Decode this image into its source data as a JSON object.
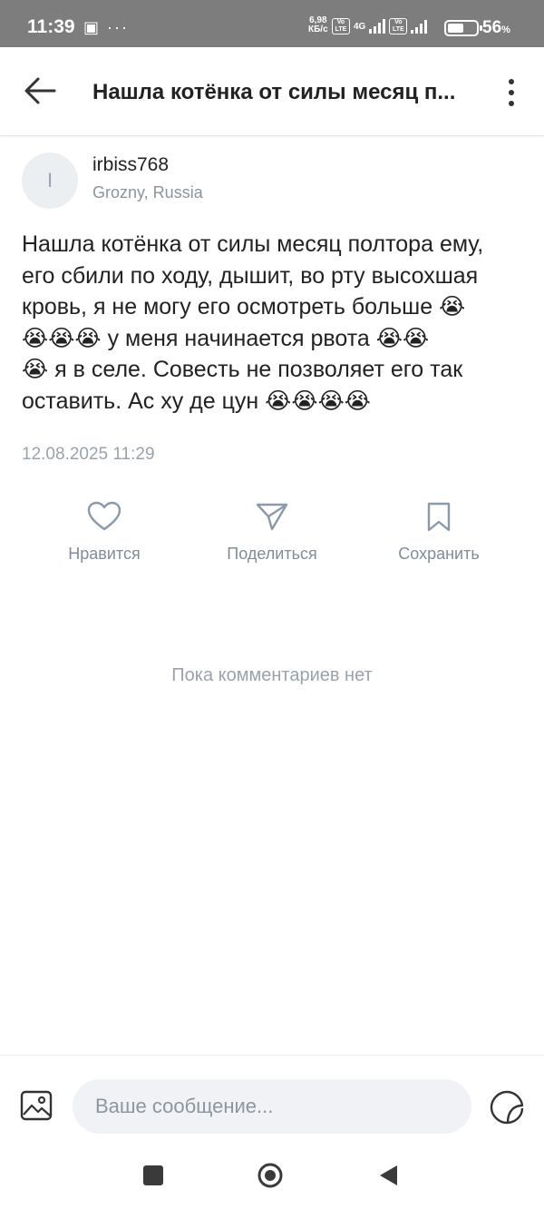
{
  "status_bar": {
    "time": "11:39",
    "left_icons": "▣ ···",
    "speed_value": "6,98",
    "speed_unit": "КБ/с",
    "volte1": "Vo LTE",
    "net": "4G",
    "volte2": "Vo LTE",
    "battery_level": 0.56,
    "battery_text": "56",
    "battery_unit": "%"
  },
  "header": {
    "title": "Нашла котёнка от силы месяц п...",
    "back_icon": "arrow-left-icon",
    "more_icon": "more-vertical-icon"
  },
  "author": {
    "initial": "I",
    "name": "irbiss768",
    "location": "Grozny, Russia"
  },
  "post": {
    "lines": [
      "Нашла котёнка от силы месяц полтора ему,",
      "его сбили по ходу, дышит, во рту высохшая",
      "кровь, я не могу его осмотреть больше 😭",
      "😭😭😭 у меня начинается рвота 😭😭",
      "😭 я в селе. Совесть не позволяет его так",
      "оставить. Ас ху де цун 😭😭😭😭"
    ],
    "date": "12.08.2025 11:29"
  },
  "actions": {
    "like_label": "Нравится",
    "share_label": "Поделиться",
    "save_label": "Сохранить"
  },
  "comments": {
    "empty_text": "Пока комментариев нет"
  },
  "composer": {
    "placeholder": "Ваше сообщение..."
  },
  "colors": {
    "status_bar_bg": "#7d7d7d",
    "icon_accent": "#8b9aaa",
    "muted_text": "#818c99"
  }
}
